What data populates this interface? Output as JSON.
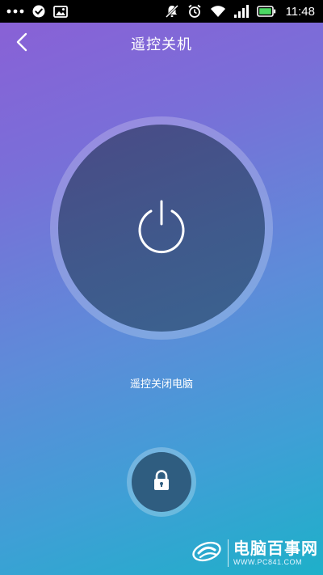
{
  "status_bar": {
    "time": "11:48",
    "left_icons": [
      "more-dots-icon",
      "check-circle-icon",
      "image-icon"
    ],
    "right_icons": [
      "mute-icon",
      "alarm-icon",
      "wifi-icon",
      "signal-icon",
      "battery-icon"
    ]
  },
  "header": {
    "title": "遥控关机",
    "back_icon": "chevron-left-icon"
  },
  "power": {
    "label": "遥控关闭电脑",
    "icon": "power-icon"
  },
  "lock": {
    "icon": "lock-icon"
  },
  "watermark": {
    "name": "电脑百事网",
    "url": "WWW.PC841.COM"
  },
  "colors": {
    "gradient_top": "#8b5fd6",
    "gradient_bottom": "#1eb0c9",
    "power_button": "#3f5a8c",
    "lock_button": "#2f5d80"
  }
}
